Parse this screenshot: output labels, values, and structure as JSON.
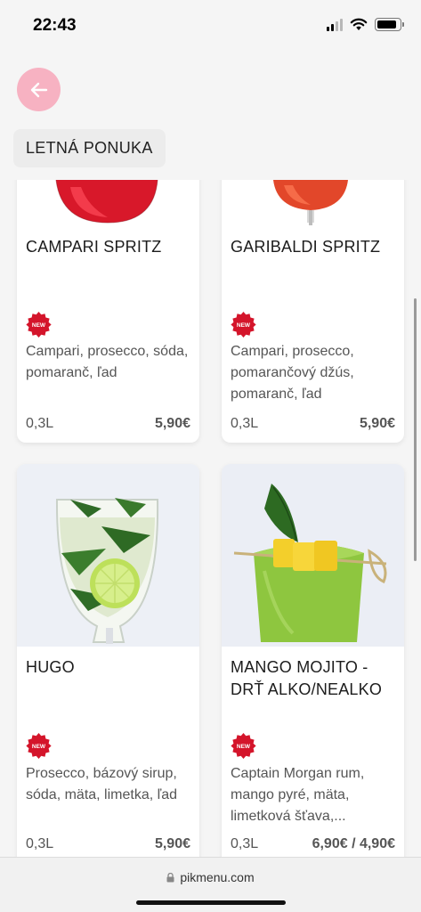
{
  "status": {
    "time": "22:43"
  },
  "header": {
    "section_title": "LETNÁ PONUKA"
  },
  "colors": {
    "accent": "#f7b2c2",
    "badge": "#d4152b"
  },
  "badge": {
    "text": "NEW"
  },
  "items": [
    {
      "name": "CAMPARI SPRITZ",
      "description": "Campari, prosecco, sóda, pomaranč, ľad",
      "volume": "0,3L",
      "price": "5,90€",
      "is_new": true
    },
    {
      "name": "GARIBALDI SPRITZ",
      "description": "Campari, prosecco, pomarančový džús, pomaranč, ľad",
      "volume": "0,3L",
      "price": "5,90€",
      "is_new": true
    },
    {
      "name": "HUGO",
      "description": "Prosecco, bázový sirup, sóda, mäta, limetka, ľad",
      "volume": "0,3L",
      "price": "5,90€",
      "is_new": true
    },
    {
      "name": "MANGO MOJITO - DRŤ ALKO/NEALKO",
      "description": "Captain Morgan rum, mango pyré, mäta, limetková šťava,...",
      "volume": "0,3L",
      "price": "6,90€ / 4,90€",
      "is_new": true
    }
  ],
  "browser": {
    "url": "pikmenu.com"
  }
}
